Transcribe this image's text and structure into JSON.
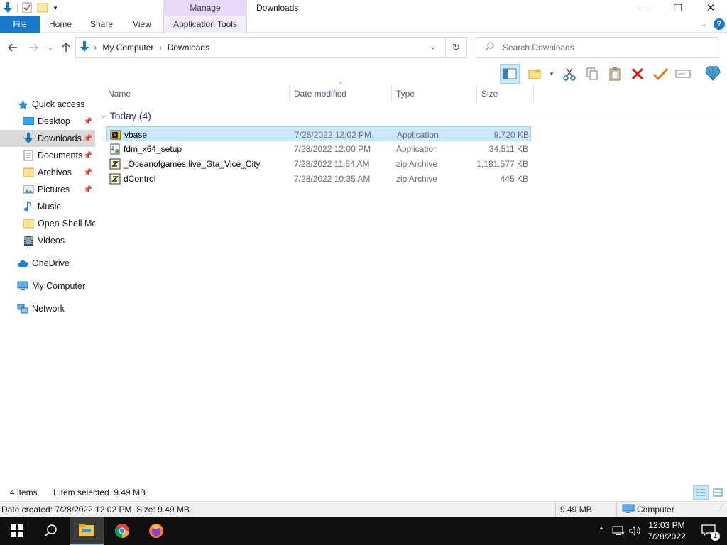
{
  "window": {
    "title": "Downloads",
    "contextual_group": "Manage",
    "controls": {
      "minimize": "—",
      "maximize": "❐",
      "close": "✕"
    }
  },
  "ribbon": {
    "tabs": [
      "File",
      "Home",
      "Share",
      "View",
      "Application Tools"
    ],
    "help": "?"
  },
  "address": {
    "crumbs": [
      "My Computer",
      "Downloads"
    ],
    "search_placeholder": "Search Downloads"
  },
  "nav": {
    "quick_access": "Quick access",
    "items": [
      {
        "label": "Desktop",
        "pinned": true,
        "icon": "desktop-icon"
      },
      {
        "label": "Downloads",
        "pinned": true,
        "icon": "download-arrow-icon",
        "selected": true
      },
      {
        "label": "Documents",
        "pinned": true,
        "icon": "documents-icon"
      },
      {
        "label": "Archivos",
        "pinned": true,
        "icon": "folder-icon"
      },
      {
        "label": "Pictures",
        "pinned": true,
        "icon": "pictures-icon"
      },
      {
        "label": "Music",
        "pinned": false,
        "icon": "music-icon"
      },
      {
        "label": "Open-Shell Mo",
        "pinned": false,
        "icon": "folder-icon"
      },
      {
        "label": "Videos",
        "pinned": false,
        "icon": "videos-icon"
      }
    ],
    "onedrive": "OneDrive",
    "mycomputer": "My Computer",
    "network": "Network"
  },
  "columns": {
    "name": "Name",
    "date": "Date modified",
    "type": "Type",
    "size": "Size"
  },
  "group": {
    "label": "Today (4)"
  },
  "files": [
    {
      "name": "vbase",
      "date": "7/28/2022 12:02 PM",
      "type": "Application",
      "size": "9,720 KB",
      "selected": true
    },
    {
      "name": "fdm_x64_setup",
      "date": "7/28/2022 12:00 PM",
      "type": "Application",
      "size": "34,511 KB"
    },
    {
      "name": "_Oceanofgames.live_Gta_Vice_City",
      "date": "7/28/2022 11:54 AM",
      "type": "zip Archive",
      "size": "1,181,577 KB"
    },
    {
      "name": "dControl",
      "date": "7/28/2022 10:35 AM",
      "type": "zip Archive",
      "size": "445 KB"
    }
  ],
  "status": {
    "count": "4 items",
    "selection": "1 item selected  9.49 MB"
  },
  "details": {
    "info": "Date created: 7/28/2022 12:02 PM, Size: 9.49 MB",
    "size": "9.49 MB",
    "location": "Computer"
  },
  "taskbar": {
    "time": "12:03 PM",
    "date": "7/28/2022",
    "notifications": "1"
  },
  "colors": {
    "accent": "#1979ca",
    "selection": "#cce8ff",
    "group_header": "#1e3287"
  }
}
